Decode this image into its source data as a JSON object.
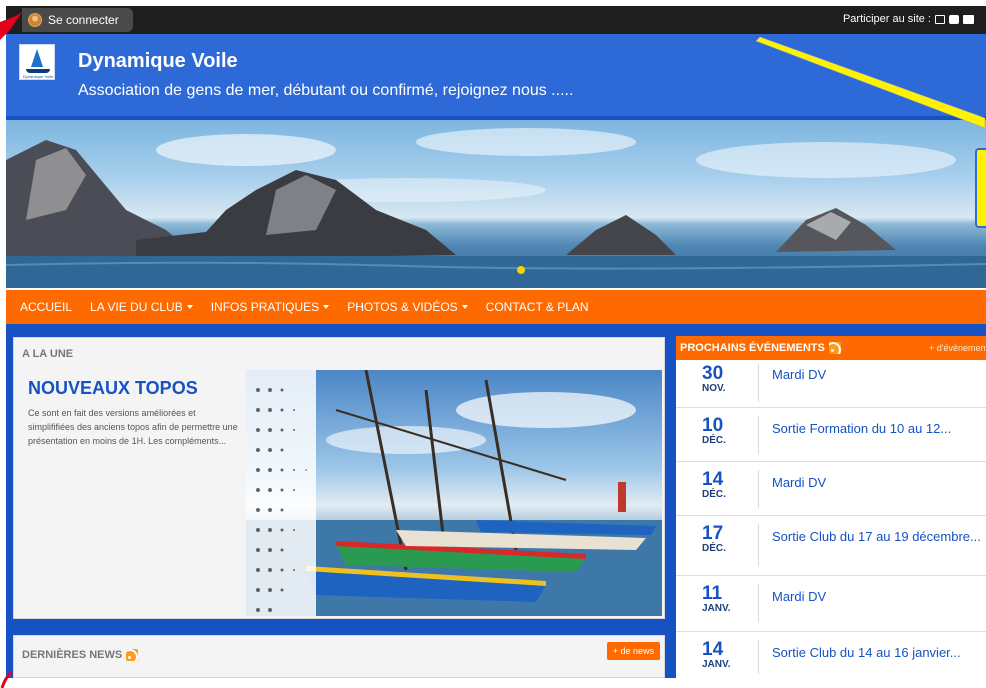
{
  "topbar": {
    "login_label": "Se connecter",
    "participate_label": "Participer au site :",
    "icons": [
      "edit-icon",
      "camera-icon",
      "video-icon"
    ]
  },
  "header": {
    "title": "Dynamique Voile",
    "slogan": "Association de gens de mer, débutant ou confirmé, rejoignez nous .....",
    "logo_text": "Dynamique Voile"
  },
  "nav": {
    "items": [
      {
        "label": "ACCUEIL",
        "dropdown": false
      },
      {
        "label": "LA VIE DU CLUB",
        "dropdown": true
      },
      {
        "label": "INFOS PRATIQUES",
        "dropdown": true
      },
      {
        "label": "PHOTOS & VIDÉOS",
        "dropdown": true
      },
      {
        "label": "CONTACT & PLAN",
        "dropdown": false
      }
    ]
  },
  "alaune": {
    "heading": "A LA UNE",
    "title": "NOUVEAUX TOPOS",
    "excerpt": "Ce sont en fait des versions améliorées et simplififiées des anciens topos afin de permettre une présentation en moins de 1H. Les compléments..."
  },
  "news": {
    "heading": "DERNIÈRES NEWS",
    "more_label": "+ de news"
  },
  "events": {
    "heading": "PROCHAINS ÉVÉNEMENTS",
    "more_label": "+ d'évènement",
    "items": [
      {
        "day": "30",
        "month": "NOV.",
        "title": "Mardi DV"
      },
      {
        "day": "10",
        "month": "DÉC.",
        "title": "Sortie Formation du 10 au 12..."
      },
      {
        "day": "14",
        "month": "DÉC.",
        "title": "Mardi DV"
      },
      {
        "day": "17",
        "month": "DÉC.",
        "title": "Sortie Club du 17 au 19 décembre..."
      },
      {
        "day": "11",
        "month": "JANV.",
        "title": "Mardi DV"
      },
      {
        "day": "14",
        "month": "JANV.",
        "title": "Sortie Club du 14 au 16 janvier..."
      }
    ]
  },
  "colors": {
    "brand_blue": "#2d6ad8",
    "dark_blue": "#1652c4",
    "accent_orange": "#ff6a00",
    "topbar": "#1e1e1e"
  }
}
